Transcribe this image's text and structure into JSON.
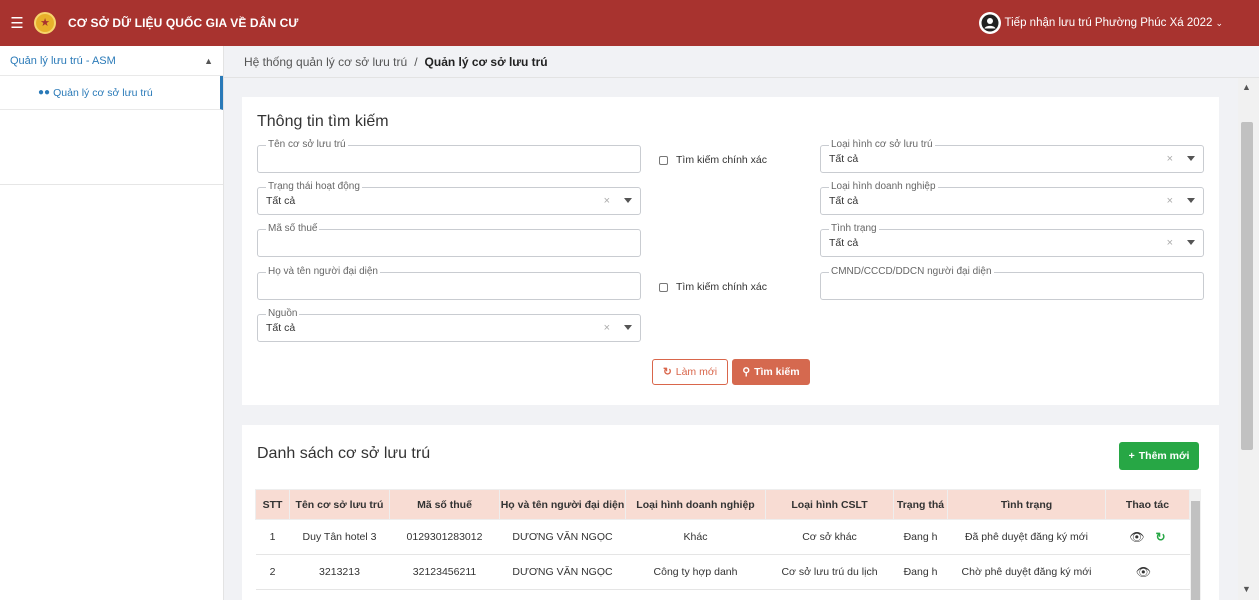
{
  "header": {
    "app_title": "CƠ SỞ DỮ LIỆU QUỐC GIA VỀ DÂN CƯ",
    "user_label": "Tiếp nhận lưu trú Phường Phúc Xá 2022",
    "menu_icon": "hamburger-icon",
    "brand_color": "#a8332f"
  },
  "sidebar": {
    "group_label": "Quản lý lưu trú - ASM",
    "items": [
      {
        "label": "Quản lý cơ sở lưu trú",
        "icon": "users-icon"
      }
    ],
    "accent_color": "#2a7ab8"
  },
  "breadcrumb": {
    "home": "Hệ thống quản lý cơ sở lưu trú",
    "separator": "/",
    "current": "Quản lý cơ sở lưu trú"
  },
  "search": {
    "title": "Thông tin tìm kiếm",
    "fields": {
      "ten_co_so": {
        "label": "Tên cơ sở lưu trú",
        "value": ""
      },
      "loai_hinh_csl": {
        "label": "Loại hình cơ sở lưu trú",
        "value": "Tất cả"
      },
      "trang_thai": {
        "label": "Trạng thái hoạt động",
        "value": "Tất cả"
      },
      "loai_hinh_dn": {
        "label": "Loại hình doanh nghiệp",
        "value": "Tất cả"
      },
      "ma_so_thue": {
        "label": "Mã số thuế",
        "value": ""
      },
      "tinh_trang": {
        "label": "Tình trạng",
        "value": "Tất cả"
      },
      "ho_ten": {
        "label": "Họ và tên người đại diện",
        "value": ""
      },
      "cmnd": {
        "label": "CMND/CCCD/DDCN người đại diện",
        "value": ""
      },
      "nguon": {
        "label": "Nguồn",
        "value": "Tất cả"
      }
    },
    "exact_match_label": "Tìm kiếm chính xác",
    "clear_symbol": "×",
    "refresh_label": "Làm mới",
    "search_label": "Tìm kiếm",
    "search_color": "#d5694f"
  },
  "list": {
    "title": "Danh sách cơ sở lưu trú",
    "add_label": "Thêm mới",
    "add_color": "#27a745",
    "columns": [
      "STT",
      "Tên cơ sở lưu trú",
      "Mã số thuế",
      "Họ và tên người đại diện",
      "Loại hình doanh nghiệp",
      "Loại hình CSLT",
      "Trạng thá",
      "Tình trạng",
      "Thao tác"
    ],
    "rows": [
      {
        "stt": "1",
        "ten": "Duy Tân hotel 3",
        "mst": "0129301283012",
        "nguoi_dai_dien": "DƯƠNG VĂN NGỌC",
        "loai_dn": "Khác",
        "loai_cslt": "Cơ sở khác",
        "trang_thai": "Đang h",
        "tinh_trang": "Đã phê duyệt đăng ký mới",
        "actions": [
          "eye-icon",
          "sync-icon"
        ]
      },
      {
        "stt": "2",
        "ten": "3213213",
        "mst": "32123456211",
        "nguoi_dai_dien": "DƯƠNG VĂN NGỌC",
        "loai_dn": "Công ty hợp danh",
        "loai_cslt": "Cơ sở lưu trú du lịch",
        "trang_thai": "Đang h",
        "tinh_trang": "Chờ phê duyệt đăng ký mới",
        "actions": [
          "eye-icon"
        ]
      }
    ]
  }
}
